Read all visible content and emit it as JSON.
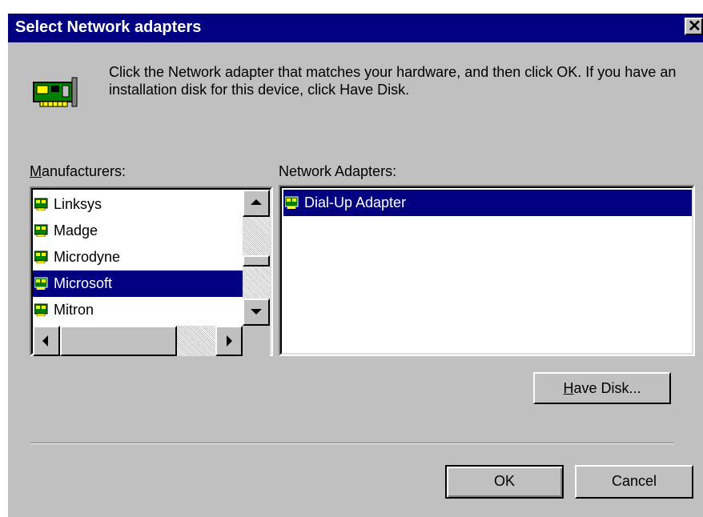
{
  "dialog": {
    "title": "Select Network adapters",
    "close_glyph": "✕",
    "description": "Click the Network adapter that matches your hardware, and then click OK. If you have an installation disk for this device, click Have Disk.",
    "icon": "network-card-icon"
  },
  "manufacturers": {
    "label_mnemonic": "M",
    "label_rest": "anufacturers:",
    "items": [
      {
        "label": "Linksys",
        "selected": false
      },
      {
        "label": "Madge",
        "selected": false
      },
      {
        "label": "Microdyne",
        "selected": false
      },
      {
        "label": "Microsoft",
        "selected": true
      },
      {
        "label": "Mitron",
        "selected": false
      }
    ]
  },
  "adapters": {
    "label": "Network Adapters:",
    "items": [
      {
        "label": "Dial-Up Adapter",
        "selected": true
      }
    ]
  },
  "buttons": {
    "have_disk_mnemonic": "H",
    "have_disk_rest": "ave Disk...",
    "ok": "OK",
    "cancel": "Cancel"
  },
  "colors": {
    "title_bar": "#000080",
    "selection": "#000080",
    "face": "#c0c0c0"
  }
}
